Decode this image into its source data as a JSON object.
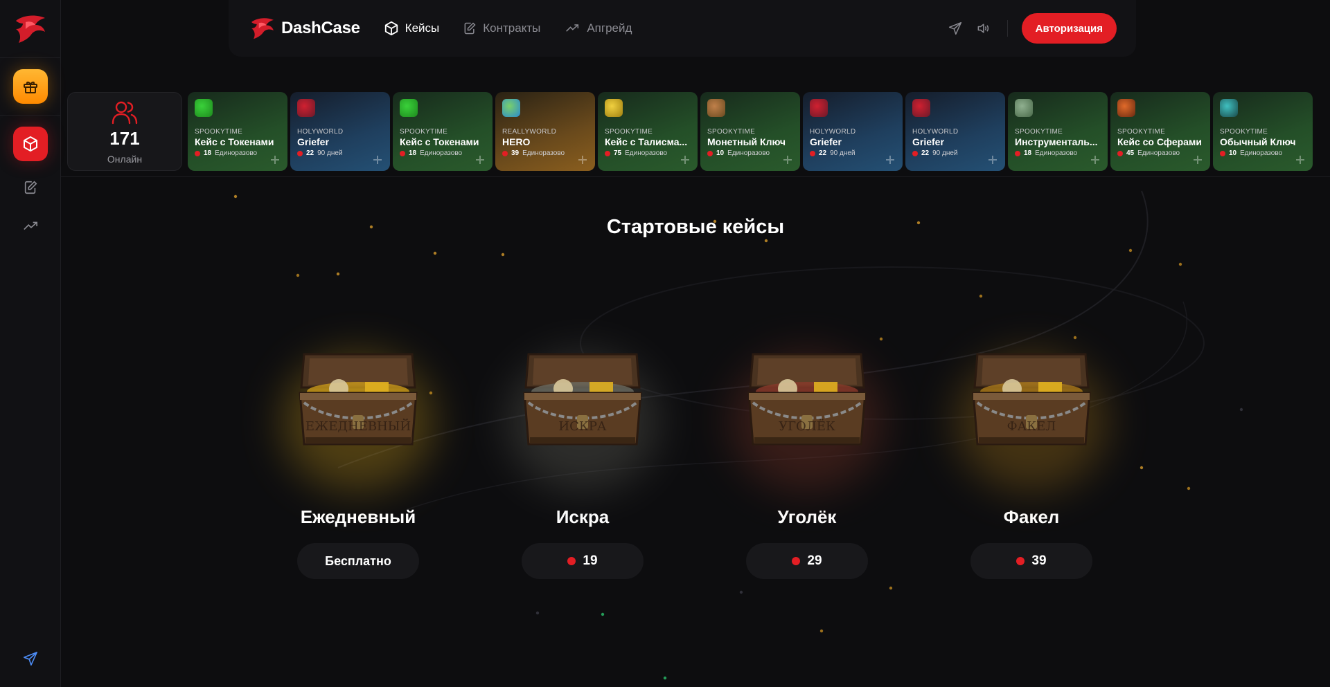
{
  "brand": {
    "name": "DashCase",
    "logo_icon": "red-dragon-logo"
  },
  "colors": {
    "accent": "#e31e24",
    "gift": "#ffa21a",
    "background": "#0d0d0f"
  },
  "nav": [
    {
      "label": "Кейсы",
      "icon": "cube-icon",
      "active": true
    },
    {
      "label": "Контракты",
      "icon": "edit-document-icon",
      "active": false
    },
    {
      "label": "Апгрейд",
      "icon": "trending-up-icon",
      "active": false
    }
  ],
  "header": {
    "auth_label": "Авторизация"
  },
  "online": {
    "count": "171",
    "label": "Онлайн"
  },
  "live_drops": [
    {
      "server": "SPOOKYTIME",
      "title": "Кейс с Токенами",
      "price": "18",
      "duration": "Единоразово",
      "theme": "green",
      "icon": "green-blob"
    },
    {
      "server": "HOLYWORLD",
      "title": "Griefer",
      "price": "22",
      "duration": "90 дней",
      "theme": "blue",
      "icon": "red-rank"
    },
    {
      "server": "SPOOKYTIME",
      "title": "Кейс с Токенами",
      "price": "18",
      "duration": "Единоразово",
      "theme": "green",
      "icon": "green-blob"
    },
    {
      "server": "REALLYWORLD",
      "title": "HERO",
      "price": "39",
      "duration": "Единоразово",
      "theme": "gold",
      "icon": "hero-avatar"
    },
    {
      "server": "SPOOKYTIME",
      "title": "Кейс с Талисма...",
      "price": "75",
      "duration": "Единоразово",
      "theme": "green",
      "icon": "talisman"
    },
    {
      "server": "SPOOKYTIME",
      "title": "Монетный Ключ",
      "price": "10",
      "duration": "Единоразово",
      "theme": "green",
      "icon": "coin-key"
    },
    {
      "server": "HOLYWORLD",
      "title": "Griefer",
      "price": "22",
      "duration": "90 дней",
      "theme": "blue",
      "icon": "red-rank"
    },
    {
      "server": "HOLYWORLD",
      "title": "Griefer",
      "price": "22",
      "duration": "90 дней",
      "theme": "blue",
      "icon": "red-rank"
    },
    {
      "server": "SPOOKYTIME",
      "title": "Инструменталь...",
      "price": "18",
      "duration": "Единоразово",
      "theme": "green",
      "icon": "tools"
    },
    {
      "server": "SPOOKYTIME",
      "title": "Кейс со Сферами",
      "price": "45",
      "duration": "Единоразово",
      "theme": "green",
      "icon": "spheres"
    },
    {
      "server": "SPOOKYTIME",
      "title": "Обычный Ключ",
      "price": "10",
      "duration": "Единоразово",
      "theme": "green",
      "icon": "key"
    }
  ],
  "starter": {
    "title": "Стартовые кейсы",
    "cases": [
      {
        "name": "Ежедневный",
        "price": "Бесплатно",
        "free": true,
        "chest_label": "ЕЖЕДНЕВНЫЙ",
        "glow": "#c99a1a"
      },
      {
        "name": "Искра",
        "price": "19",
        "free": false,
        "chest_label": "ИСКРА",
        "glow": "#6a6a60"
      },
      {
        "name": "Уголёк",
        "price": "29",
        "free": false,
        "chest_label": "УГОЛЁК",
        "glow": "#8a3a2a"
      },
      {
        "name": "Факел",
        "price": "39",
        "free": false,
        "chest_label": "ФАКЕЛ",
        "glow": "#a9781a"
      }
    ]
  }
}
